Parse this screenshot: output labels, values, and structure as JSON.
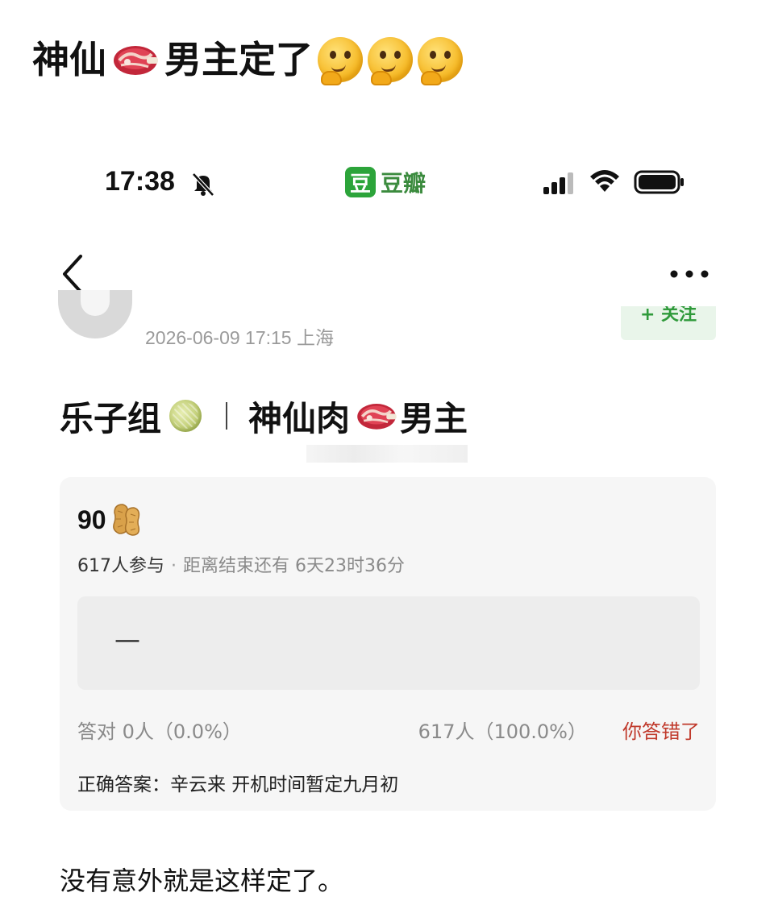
{
  "caption": {
    "text": "神仙",
    "text2": "男主定了",
    "meat_icon": "meat-emoji",
    "think_icon": "thinking-face-emoji"
  },
  "status_bar": {
    "time": "17:38",
    "app_logo": "豆",
    "app_name": "豆瓣",
    "icons": [
      "bell-muted-icon",
      "signal-icon",
      "wifi-icon",
      "battery-icon"
    ]
  },
  "nav": {
    "back_icon": "chevron-left-icon",
    "more_icon": "more-dots-icon"
  },
  "author": {
    "meta": "2026-06-09 17:15  上海",
    "follow_label": "+ 关注"
  },
  "post": {
    "group": "乐子组",
    "title": "神仙肉",
    "title_suffix": "男主",
    "body": "没有意外就是这样定了。"
  },
  "quiz": {
    "points": "90",
    "participants": "617人参与",
    "dot": "·",
    "remaining": "距离结束还有 6天23时36分",
    "option_text": "—",
    "correct_count": "答对  0人（0.0%）",
    "wrong_count": "617人（100.0%）",
    "wrong_label": "你答错了",
    "correct_answer": "正确答案：辛云来 开机时间暂定九月初"
  },
  "colors": {
    "douban_green": "#2ca43a",
    "wrong_red": "#c0392b",
    "card_bg": "#f6f6f6"
  }
}
